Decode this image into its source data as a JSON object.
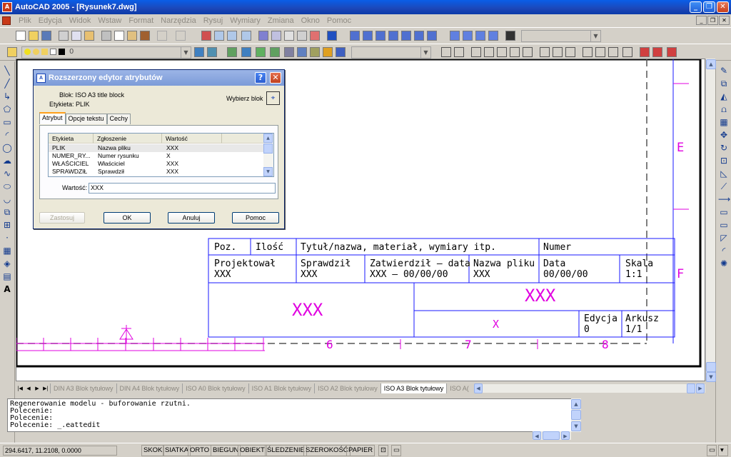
{
  "window": {
    "title": "AutoCAD 2005 - [Rysunek7.dwg]",
    "app_icon": "A",
    "min_icon": "_",
    "max_icon": "❐",
    "close_icon": "✕"
  },
  "menu": [
    "Plik",
    "Edycja",
    "Widok",
    "Wstaw",
    "Format",
    "Narzędzia",
    "Rysuj",
    "Wymiary",
    "Zmiana",
    "Okno",
    "Pomoc"
  ],
  "layer_toolbar": {
    "current_layer": "0"
  },
  "dialog": {
    "title": "Rozszerzony edytor atrybutów",
    "help_icon": "?",
    "close_icon": "✕",
    "block_label": "Blok: ISO A3 title block",
    "tag_label": "Etykieta: PLIK",
    "select_block": "Wybierz blok",
    "tabs": [
      "Atrybut",
      "Opcje tekstu",
      "Cechy"
    ],
    "columns": [
      "Etykieta",
      "Zgłoszenie",
      "Wartość"
    ],
    "rows": [
      {
        "tag": "PLIK",
        "prompt": "Nazwa pliku",
        "value": "XXX"
      },
      {
        "tag": "NUMER_RY...",
        "prompt": "Numer rysunku",
        "value": "X"
      },
      {
        "tag": "WŁAŚCICIEL",
        "prompt": "Właściciel",
        "value": "XXX"
      },
      {
        "tag": "SPRAWDZIŁ",
        "prompt": "Sprawdził",
        "value": "XXX"
      }
    ],
    "value_label": "Wartość:",
    "value": "XXX",
    "buttons": {
      "apply": "Zastosuj",
      "ok": "OK",
      "cancel": "Anuluj",
      "help": "Pomoc"
    }
  },
  "title_block": {
    "row1": [
      "Poz.",
      "Ilość",
      "Tytuł/nazwa, materiał, wymiary itp.",
      "Numer"
    ],
    "designed_label": "Projektował",
    "designed_value": "XXX",
    "checked_label": "Sprawdził",
    "checked_value": "XXX",
    "approved_label": "Zatwierdził – data",
    "approved_value": "XXX – 00/00/00",
    "filename_label": "Nazwa pliku",
    "filename_value": "XXX",
    "date_label": "Data",
    "date_value": "00/00/00",
    "scale_label": "Skala",
    "scale_value": "1:1",
    "owner": "XXX",
    "title": "XXX",
    "number": "X",
    "edition_label": "Edycja",
    "edition_value": "0",
    "sheet_label": "Arkusz",
    "sheet_value": "1/1",
    "zone_numbers": [
      "6",
      "7",
      "8"
    ],
    "zone_letters": [
      "E",
      "F"
    ]
  },
  "layout_tabs": [
    "DIN A3 Blok tytułowy",
    "DIN A4 Blok tytułowy",
    "ISO A0 Blok tytułowy",
    "ISO A1 Blok tytułowy",
    "ISO A2 Blok tytułowy",
    "ISO A3 Blok tytułowy",
    "ISO A("
  ],
  "active_tab_index": 5,
  "command_lines": [
    "Regenerowanie modelu - buforowanie rzutni.",
    "Polecenie:",
    "Polecenie:",
    "Polecenie: _.eattedit"
  ],
  "status": {
    "coords": "294.6417, 11.2108, 0.0000",
    "toggles": [
      "SKOK",
      "SIATKA",
      "ORTO",
      "BIEGUN",
      "OBIEKT",
      "ŚLEDZENIE",
      "SZEROKOŚĆ",
      "PAPIER"
    ]
  },
  "colors": {
    "drawing_lines": "#1a1aff",
    "attribute_text": "#e000e0",
    "titlebar": "#0a5ee8"
  }
}
